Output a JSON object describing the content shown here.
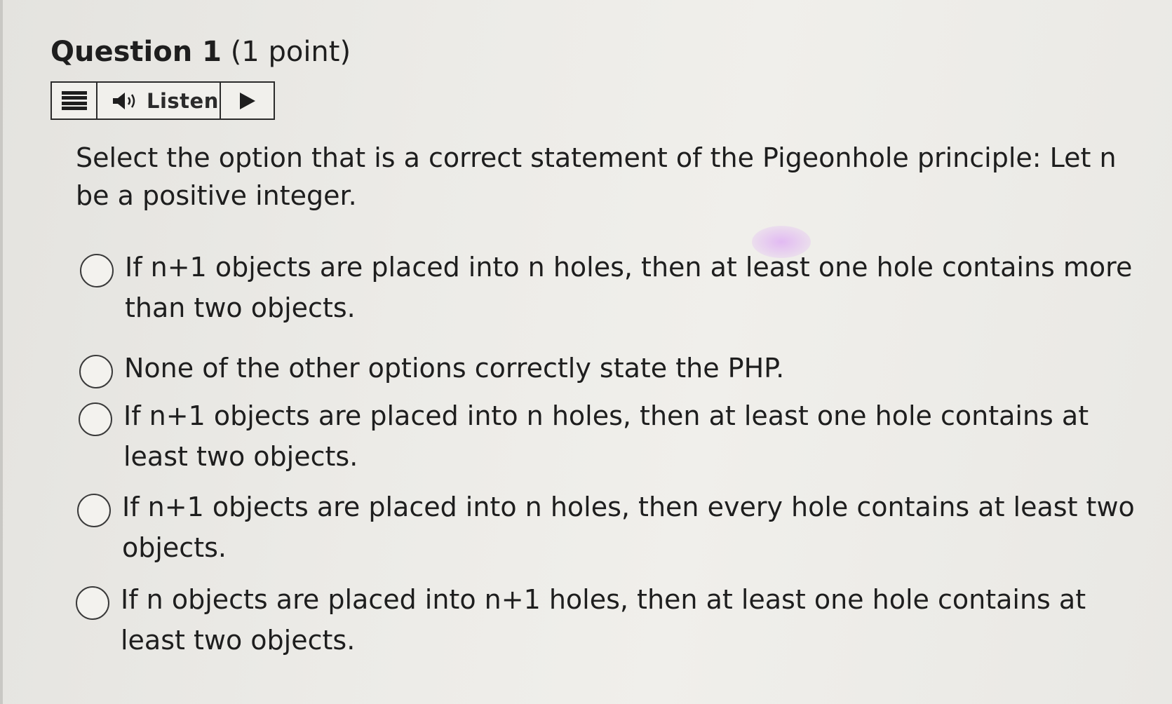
{
  "question": {
    "number_label": "Question 1",
    "points_label": "(1 point)"
  },
  "toolbar": {
    "menu_icon": "menu-icon",
    "speaker_icon": "speaker-icon",
    "listen_label": "Listen",
    "play_icon": "play-icon"
  },
  "prompt": "Select the option that is a correct statement of the Pigeonhole principle: Let n be a positive integer.",
  "options": [
    {
      "label": "If n+1 objects are placed into n holes, then at least one hole contains more than two objects.",
      "selected": false
    },
    {
      "label": "None of the other options correctly state the PHP.",
      "selected": false
    },
    {
      "label": "If n+1 objects are placed into n holes, then at least one hole contains at least two objects.",
      "selected": false
    },
    {
      "label": "If n+1 objects are placed into n holes, then every hole contains at least two objects.",
      "selected": false
    },
    {
      "label": "If n objects are placed into n+1 holes, then at least one hole contains at least two objects.",
      "selected": false
    }
  ],
  "colors": {
    "text": "#1e1e1e",
    "border": "#2b2b2b",
    "background": "#ecebe7"
  }
}
